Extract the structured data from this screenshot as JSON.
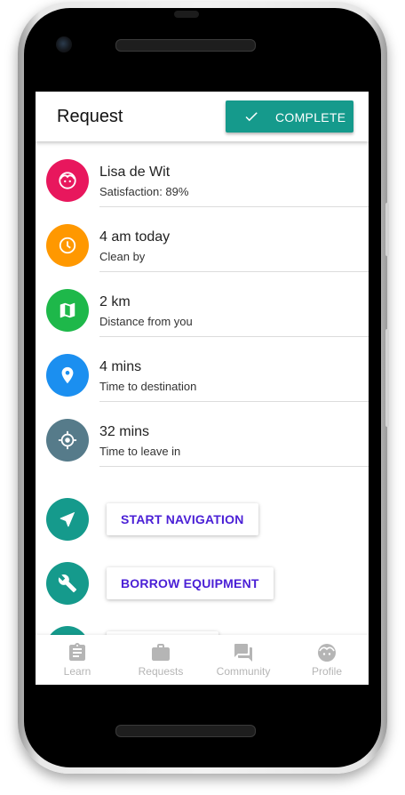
{
  "header": {
    "title": "Request",
    "complete_label": "COMPLETE"
  },
  "details": [
    {
      "primary": "Lisa de Wit",
      "secondary": "Satisfaction: 89%",
      "icon": "face-icon",
      "color": "#e8175d"
    },
    {
      "primary": "4 am today",
      "secondary": "Clean by",
      "icon": "clock-icon",
      "color": "#ff9800"
    },
    {
      "primary": "2 km",
      "secondary": "Distance from you",
      "icon": "map-icon",
      "color": "#1eb84a"
    },
    {
      "primary": "4 mins",
      "secondary": "Time to destination",
      "icon": "location-pin-icon",
      "color": "#1b8ff0"
    },
    {
      "primary": "32 mins",
      "secondary": "Time to leave in",
      "icon": "gps-target-icon",
      "color": "#567b8a"
    }
  ],
  "actions": [
    {
      "label": "START NAVIGATION",
      "icon": "navigation-arrow-icon"
    },
    {
      "label": "BORROW EQUIPMENT",
      "icon": "wrench-icon"
    }
  ],
  "bottom_nav": [
    {
      "label": "Learn",
      "icon": "clipboard-icon"
    },
    {
      "label": "Requests",
      "icon": "briefcase-icon"
    },
    {
      "label": "Community",
      "icon": "forum-icon"
    },
    {
      "label": "Profile",
      "icon": "face-icon"
    }
  ],
  "colors": {
    "accent": "#159a8c",
    "action_text": "#4a1fd6",
    "nav_inactive": "#b5b5b5"
  }
}
